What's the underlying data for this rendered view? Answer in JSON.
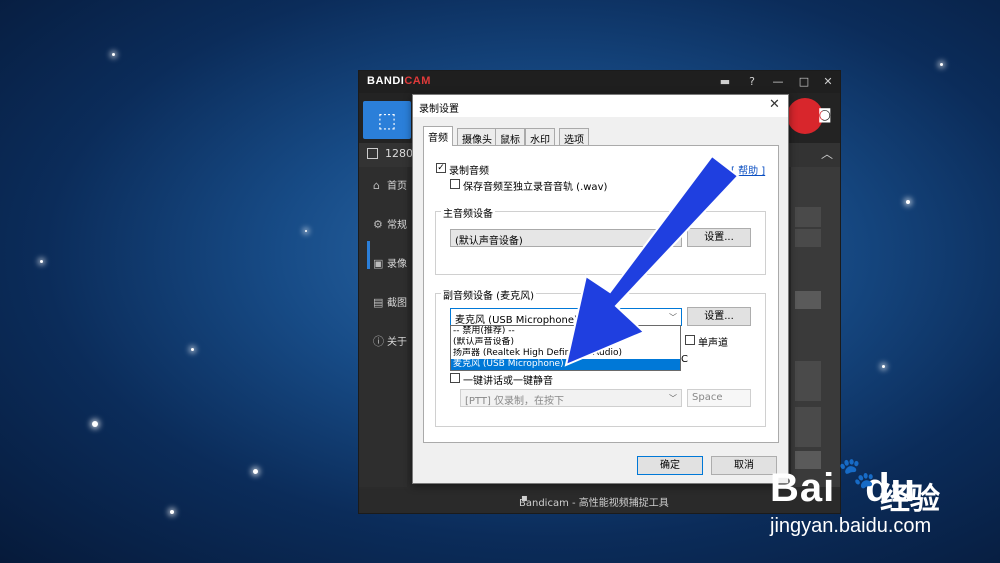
{
  "bandicam": {
    "logo_a": "BANDI",
    "logo_b": "CAM",
    "resolution": "1280x",
    "sidebar": [
      {
        "label": "首页",
        "icon": "home-icon"
      },
      {
        "label": "常规",
        "icon": "gear-icon"
      },
      {
        "label": "录像",
        "icon": "video-settings-icon"
      },
      {
        "label": "截图",
        "icon": "screenshot-icon"
      },
      {
        "label": "关于",
        "icon": "info-icon"
      }
    ],
    "status": "Bandicam - 高性能视频捕捉工具"
  },
  "dialog": {
    "title": "录制设置",
    "tabs": [
      "音频",
      "摄像头",
      "鼠标",
      "水印",
      "选项"
    ],
    "active_tab": "音频",
    "help_link": "[ 帮助 ]",
    "record_audio": {
      "label": "录制音频",
      "checked": true
    },
    "save_separate": {
      "label": "保存音频至独立录音音轨 (.wav)",
      "checked": false
    },
    "primary_group": {
      "title": "主音频设备",
      "value": "(默认声音设备)",
      "settings_button": "设置..."
    },
    "secondary_group": {
      "title": "副音频设备 (麦克风)",
      "value": "麦克风 (USB Microphone)",
      "settings_button": "设置...",
      "options": [
        "-- 禁用(推荐) --",
        "(默认声音设备)",
        "扬声器 (Realtek High Definition Audio)",
        "麦克风 (USB Microphone)"
      ],
      "selected_index": 3,
      "mono_label": "单声道",
      "mono_checked": false,
      "partial_char": "C",
      "ptt_label": "一键讲话或一键静音",
      "ptt_checked": false,
      "ptt_mode": "[PTT] 仅录制，在按下",
      "ptt_key": "Space"
    },
    "ok_button": "确定",
    "cancel_button": "取消"
  },
  "watermark": {
    "brand": "Bai",
    "brand2": "du",
    "cn": "经验",
    "url": "jingyan.baidu.com"
  },
  "colors": {
    "accent": "#2b7fd9",
    "record": "#d8262c",
    "arrow": "#1f3fe0",
    "selection": "#0078d7"
  }
}
